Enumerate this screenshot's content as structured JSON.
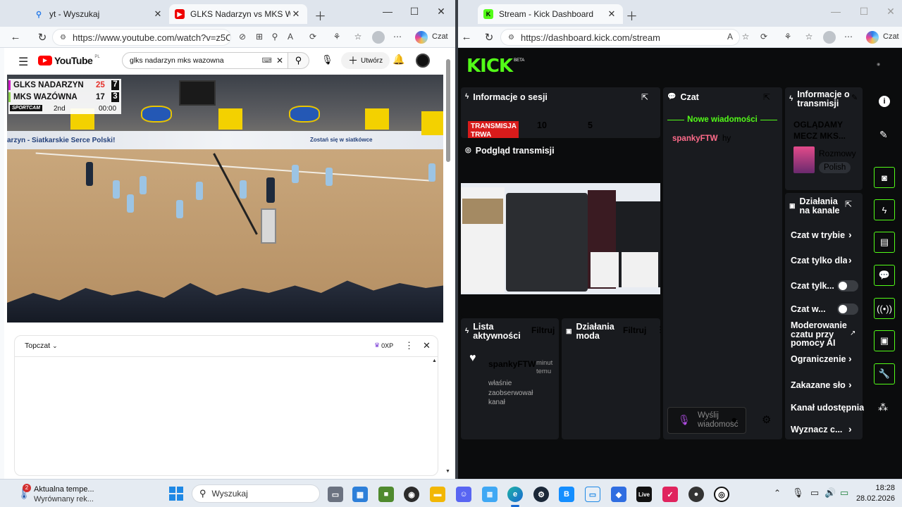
{
  "left_browser": {
    "tabs": [
      {
        "title": "yt - Wyszukaj",
        "icon": "search-icon"
      },
      {
        "title": "GLKS Nadarzyn vs MKS Wazó",
        "icon": "youtube-icon"
      }
    ],
    "url": "https://www.youtube.com/watch?v=z5O6y...",
    "copilot_label": "Czat"
  },
  "youtube": {
    "logo": "YouTube",
    "logo_region": "PL",
    "search_value": "glks nadarzyn mks wazowna",
    "create_label": "Utwórz",
    "scoreboard": {
      "team1": "GLKS NADARZYN",
      "points1": "25",
      "sets1": "7",
      "team2": "MKS WAZÓWNA",
      "points2": "17",
      "sets2": "3",
      "brand": "SPORTCAM",
      "period": "2nd",
      "clock": "00:00"
    },
    "banner_text": "arzyn - Siatkarskie Serce Polski!",
    "banner_text2": "Zostań się w siatkówce",
    "chat": {
      "mode": "Topczat",
      "points": "0XP"
    }
  },
  "right_browser": {
    "tab_title": "Stream - Kick Dashboard",
    "url": "https://dashboard.kick.com/stream",
    "copilot_label": "Czat"
  },
  "kick": {
    "logo": "KICK",
    "logo_badge": "BETA",
    "session": {
      "title": "Informacje o sesji",
      "status": "TRANSMISJA TRWA",
      "stat1": "10",
      "stat2": "5"
    },
    "preview": {
      "title": "Podgląd transmisji"
    },
    "activity": {
      "title": "Lista aktywności",
      "filter": "Filtruj",
      "item_user": "spankyFTW",
      "item_time": "minut temu",
      "item_text": "właśnie zaobserwował kanał"
    },
    "mod": {
      "title": "Działania moda",
      "filter": "Filtruj"
    },
    "chat": {
      "title": "Czat",
      "new_messages": "Nowe wiadomości",
      "messages": [
        {
          "user": "spankyFTW",
          "text": "hy"
        }
      ],
      "input_placeholder": "Wyślij wiadomość"
    },
    "stream_info": {
      "title": "Informacje o transmisji",
      "stream_title": "OGLĄDAMY MECZ MKS...",
      "category": "Rozmowy",
      "language": "Polish"
    },
    "channel_actions": {
      "title": "Działania na kanale",
      "items": [
        "Czat w trybie",
        "Czat tylko dla",
        "Czat tylk...",
        "Czat w...",
        "Moderowanie czatu przy pomocy AI",
        "Ograniczenie",
        "Zakazane sło",
        "Kanał udostępniający",
        "Wyznacz c..."
      ]
    }
  },
  "taskbar": {
    "weather_title": "Aktualna tempe...",
    "weather_sub": "Wyrównany rek...",
    "weather_badge": "2",
    "search_placeholder": "Wyszukaj",
    "time": "18:28",
    "date": "28.02.2026"
  }
}
